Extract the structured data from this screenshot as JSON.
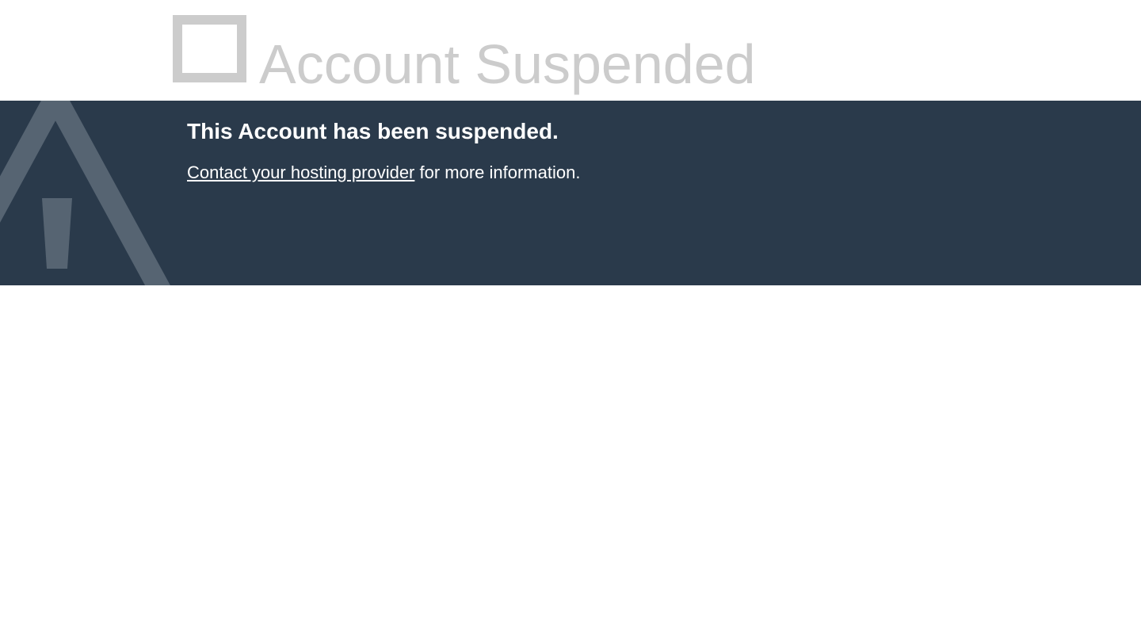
{
  "header": {
    "icon": "broken-image-icon",
    "title": "Account Suspended"
  },
  "banner": {
    "background_color": "#2a3a4b",
    "icon": "warning-icon",
    "heading": "This Account has been suspended.",
    "link_text": "Contact your hosting provider",
    "after_link_text": " for more information."
  },
  "colors": {
    "title_gray": "#cccccc",
    "warning_icon_gray": "#566472",
    "text_white": "#ffffff"
  }
}
